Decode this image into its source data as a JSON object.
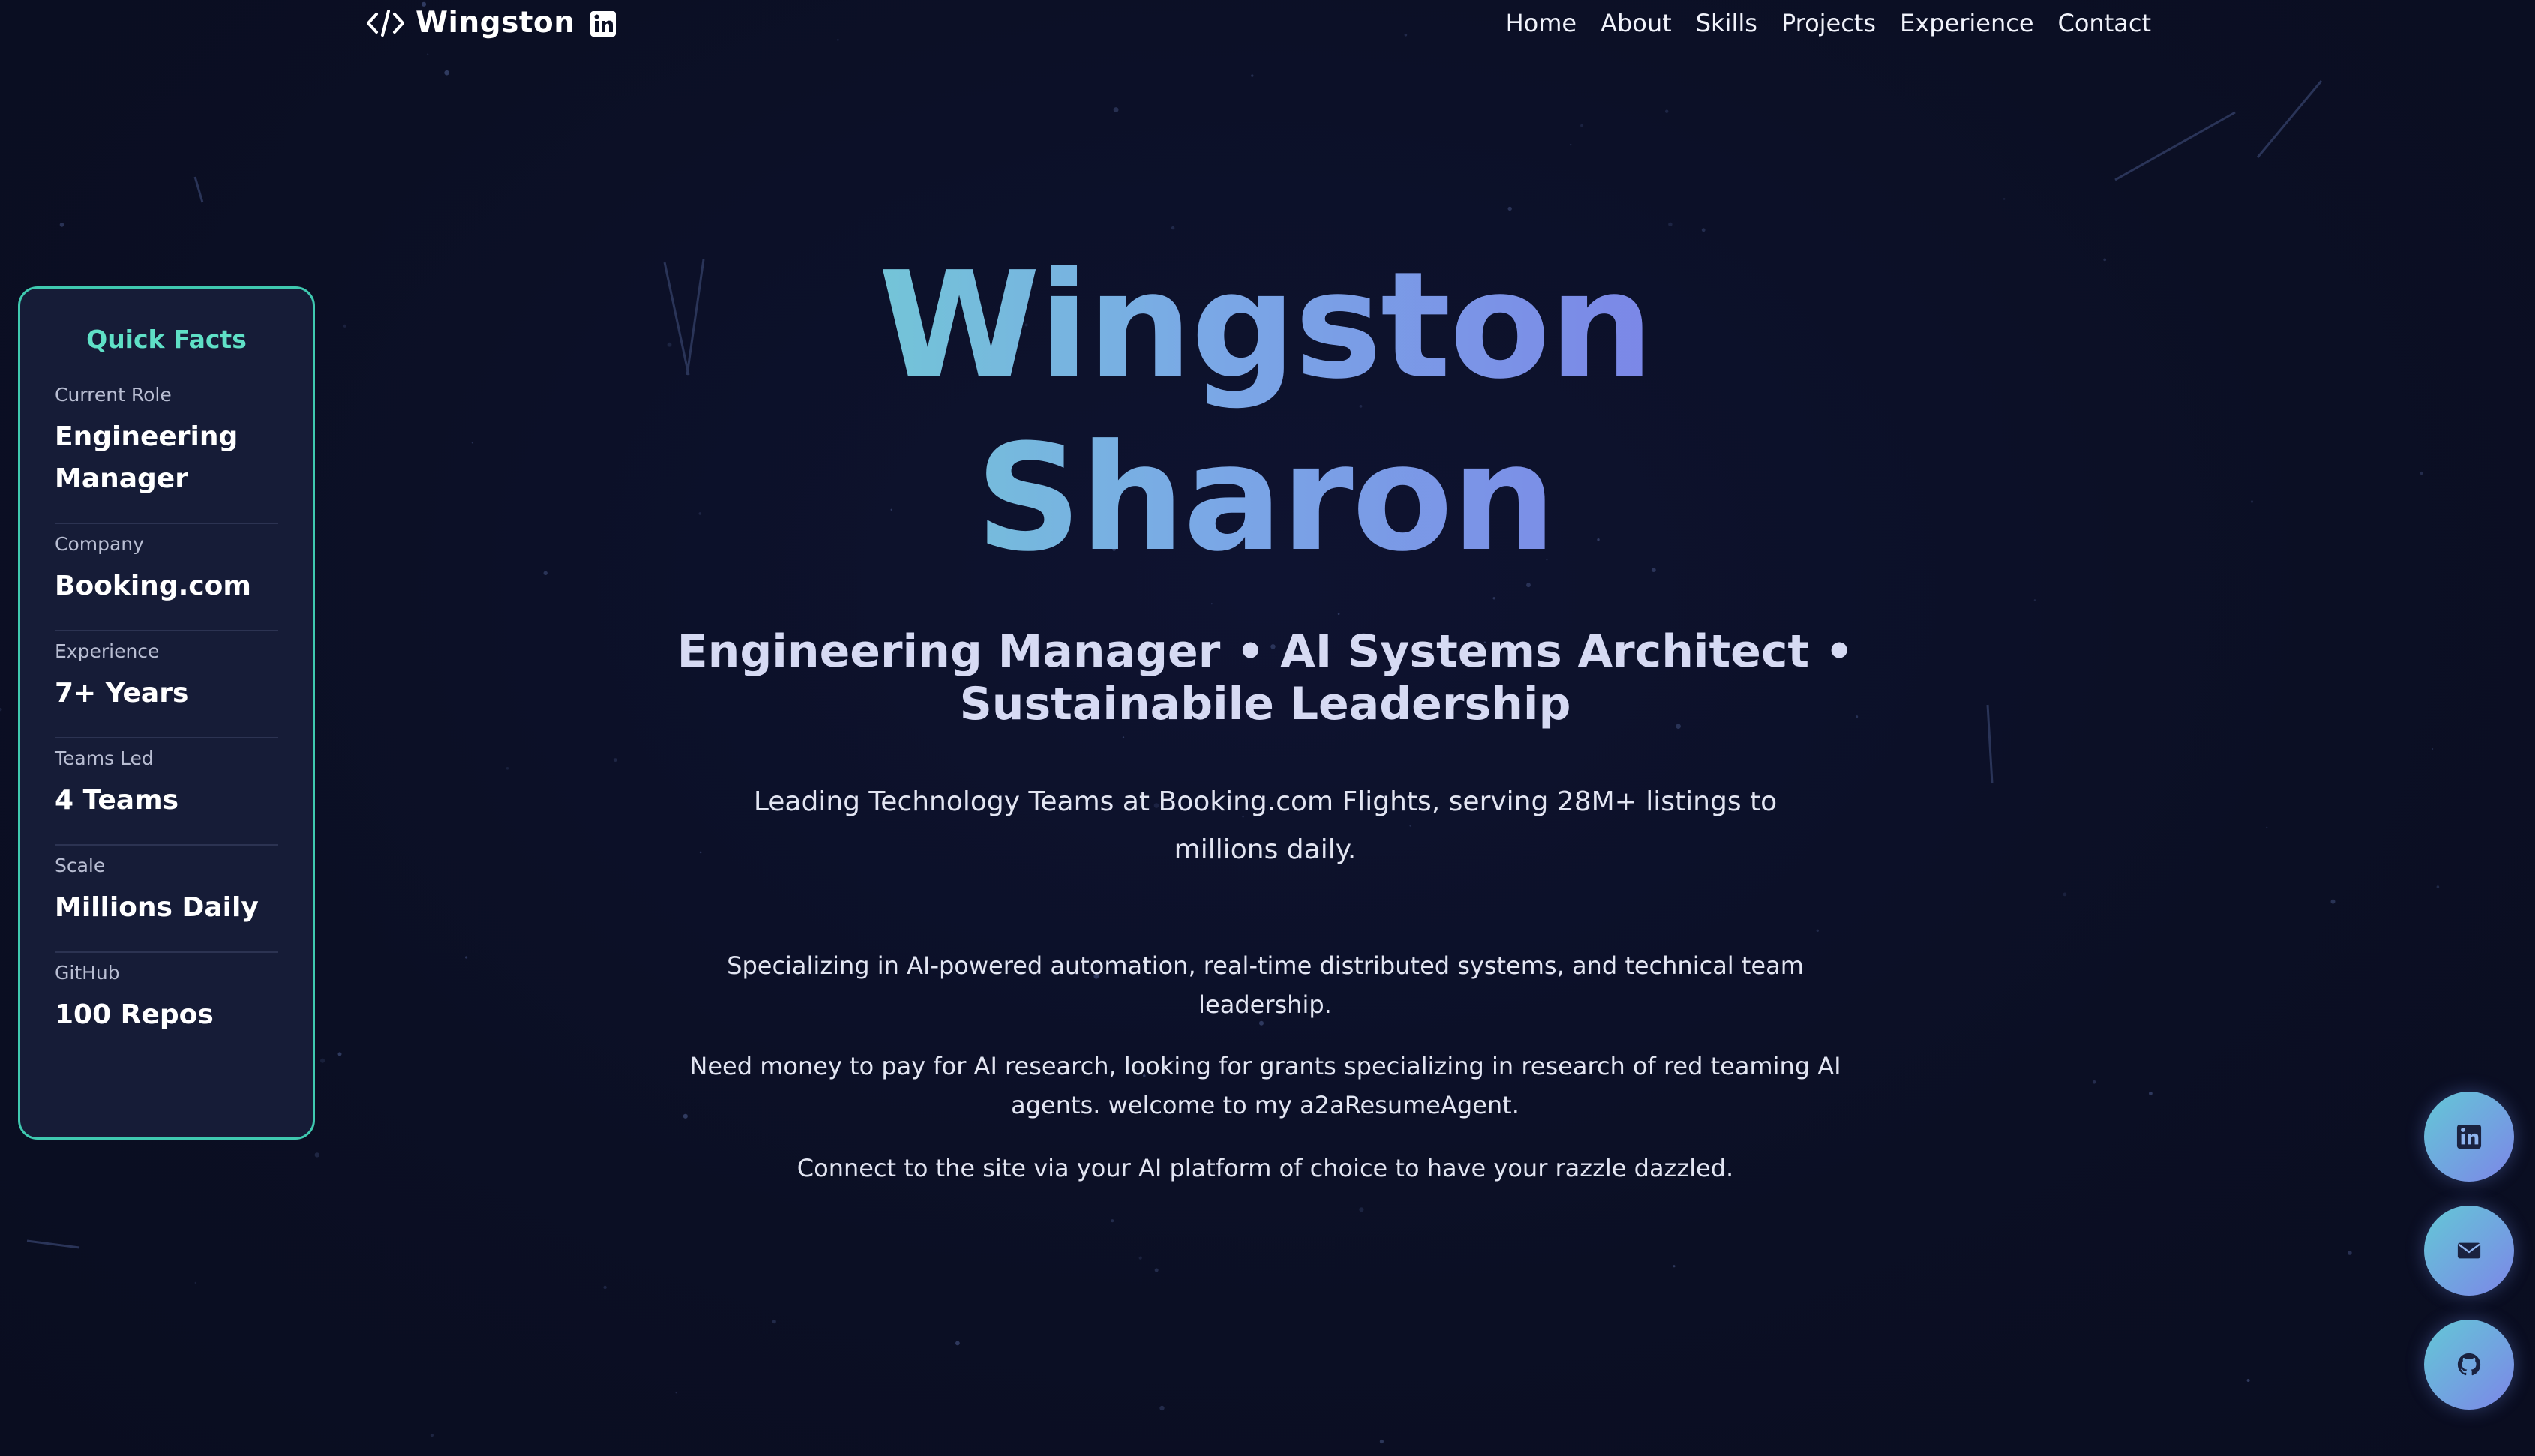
{
  "brand": {
    "logo_icon": "code-brackets-icon",
    "name": "Wingston",
    "linkedin_icon": "linkedin-icon"
  },
  "nav": {
    "links": [
      "Home",
      "About",
      "Skills",
      "Projects",
      "Experience",
      "Contact"
    ]
  },
  "quick_facts": {
    "title": "Quick Facts",
    "items": [
      {
        "label": "Current Role",
        "value": "Engineering Manager"
      },
      {
        "label": "Company",
        "value": "Booking.com"
      },
      {
        "label": "Experience",
        "value": "7+ Years"
      },
      {
        "label": "Teams Led",
        "value": "4 Teams"
      },
      {
        "label": "Scale",
        "value": "Millions Daily"
      },
      {
        "label": "GitHub",
        "value": "100 Repos"
      }
    ]
  },
  "hero": {
    "name_line1": "Wingston",
    "name_line2": "Sharon",
    "subtitle": "Engineering Manager • AI Systems Architect • Sustainabile Leadership",
    "tagline": "Leading Technology Teams at Booking.com Flights, serving 28M+ listings to millions daily.",
    "paragraphs": [
      "Specializing in AI-powered automation, real-time distributed systems, and technical team leadership.",
      "Need money to pay for AI research, looking for grants specializing in research of red teaming AI agents. welcome to my a2aResumeAgent.",
      "Connect to the site via your AI platform of choice to have your razzle dazzled."
    ]
  },
  "floating_buttons": [
    {
      "name": "linkedin",
      "icon": "linkedin-icon"
    },
    {
      "name": "email",
      "icon": "envelope-icon"
    },
    {
      "name": "github",
      "icon": "github-icon"
    }
  ],
  "colors": {
    "background": "#0b0f24",
    "accent_teal": "#5fe0c6",
    "gradient_start": "#6fd6cf",
    "gradient_end": "#7c78e8",
    "card_bg": "#161c37"
  }
}
